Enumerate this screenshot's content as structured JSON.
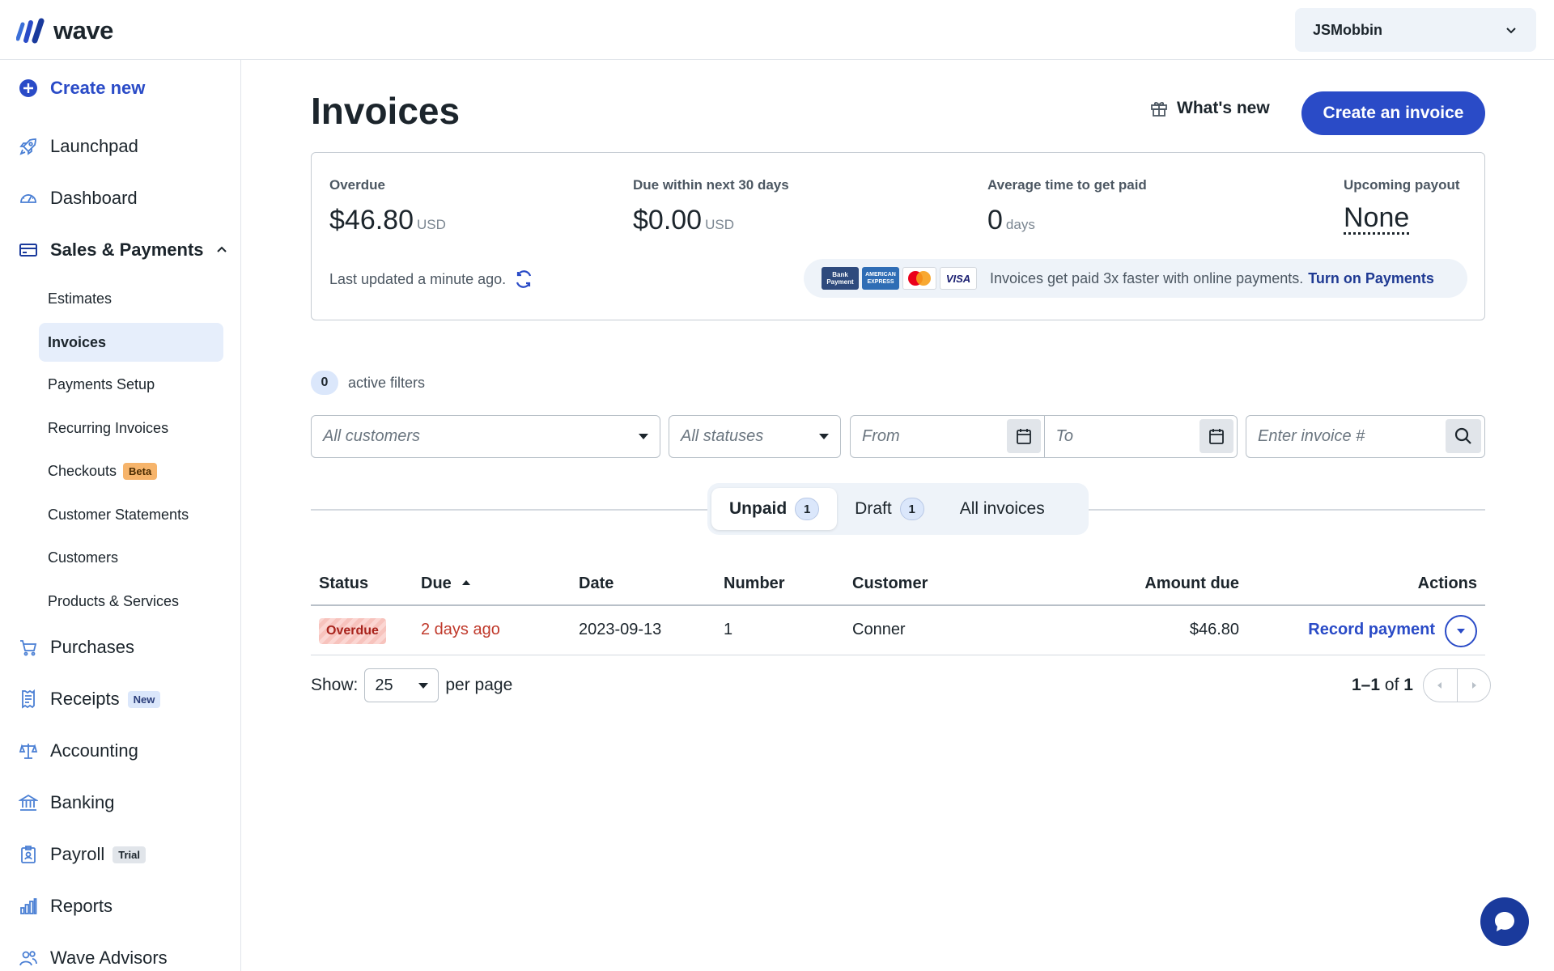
{
  "app": {
    "logo_text": "wave"
  },
  "user": {
    "name": "JSMobbin"
  },
  "sidebar": {
    "create_new": "Create new",
    "items": [
      {
        "label": "Launchpad"
      },
      {
        "label": "Dashboard"
      },
      {
        "label": "Sales & Payments"
      },
      {
        "label": "Purchases"
      },
      {
        "label": "Receipts",
        "badge": "New"
      },
      {
        "label": "Accounting"
      },
      {
        "label": "Banking"
      },
      {
        "label": "Payroll",
        "badge": "Trial"
      },
      {
        "label": "Reports"
      },
      {
        "label": "Wave Advisors"
      }
    ],
    "sub_items": [
      {
        "label": "Estimates"
      },
      {
        "label": "Invoices"
      },
      {
        "label": "Payments Setup"
      },
      {
        "label": "Recurring Invoices"
      },
      {
        "label": "Checkouts",
        "badge": "Beta"
      },
      {
        "label": "Customer Statements"
      },
      {
        "label": "Customers"
      },
      {
        "label": "Products & Services"
      }
    ]
  },
  "header": {
    "title": "Invoices",
    "whats_new": "What's new",
    "create_button": "Create an invoice"
  },
  "summary": {
    "overdue": {
      "label": "Overdue",
      "value": "$46.80",
      "unit": "USD"
    },
    "due_30": {
      "label": "Due within next 30 days",
      "value": "$0.00",
      "unit": "USD"
    },
    "avg_time": {
      "label": "Average time to get paid",
      "value": "0",
      "unit": "days"
    },
    "payout": {
      "label": "Upcoming payout",
      "value": "None"
    },
    "last_updated": "Last updated a minute ago.",
    "promo_text": "Invoices get paid 3x faster with online payments.",
    "promo_link": "Turn on Payments",
    "cards": {
      "bank": "Bank Payment",
      "amex": "AMERICAN EXPRESS",
      "visa": "VISA"
    }
  },
  "filters": {
    "active_count": "0",
    "active_label": "active filters",
    "customers_placeholder": "All customers",
    "statuses_placeholder": "All statuses",
    "from_placeholder": "From",
    "to_placeholder": "To",
    "invoice_placeholder": "Enter invoice #"
  },
  "tabs": [
    {
      "label": "Unpaid",
      "count": "1"
    },
    {
      "label": "Draft",
      "count": "1"
    },
    {
      "label": "All invoices"
    }
  ],
  "table": {
    "columns": [
      "Status",
      "Due",
      "Date",
      "Number",
      "Customer",
      "Amount due",
      "Actions"
    ],
    "rows": [
      {
        "status": "Overdue",
        "due": "2 days ago",
        "date": "2023-09-13",
        "number": "1",
        "customer": "Conner",
        "amount": "$46.80",
        "action": "Record payment"
      }
    ]
  },
  "pagination": {
    "show_label": "Show:",
    "per_page_value": "25",
    "per_page_label": "per page",
    "range": "1–1",
    "of_label": "of",
    "total": "1"
  },
  "colors": {
    "brand": "#2a4bc7",
    "overdue": "#c0392b"
  }
}
